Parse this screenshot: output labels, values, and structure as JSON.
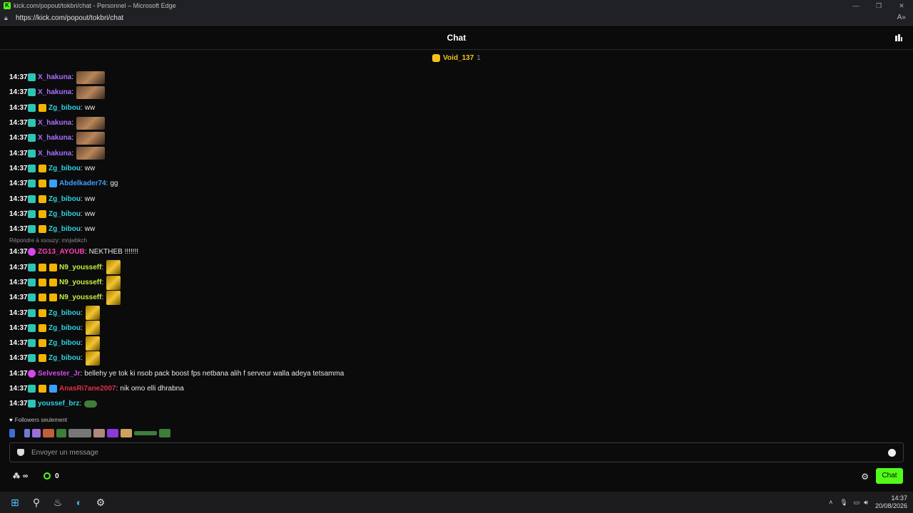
{
  "window": {
    "title": "kick.com/popout/tokbri/chat - Personnel – Microsoft Edge",
    "url": "https://kick.com/popout/tokbri/chat",
    "min": "—",
    "restore": "❐",
    "close": "✕"
  },
  "header": {
    "title": "Chat"
  },
  "pinned": {
    "user": "Void_137",
    "count": "1"
  },
  "messages": [
    {
      "time": "14:37",
      "badges": [
        "sub"
      ],
      "user": "X_hakuna",
      "color": "#a970ff",
      "emote": "photo"
    },
    {
      "time": "14:37",
      "badges": [
        "sub"
      ],
      "user": "X_hakuna",
      "color": "#a970ff",
      "emote": "photo"
    },
    {
      "time": "14:37",
      "badges": [
        "sub",
        "crown"
      ],
      "user": "Zg_bibou",
      "color": "#2ed1e0",
      "text": "ww"
    },
    {
      "time": "14:37",
      "badges": [
        "sub"
      ],
      "user": "X_hakuna",
      "color": "#a970ff",
      "emote": "photo"
    },
    {
      "time": "14:37",
      "badges": [
        "sub"
      ],
      "user": "X_hakuna",
      "color": "#a970ff",
      "emote": "photo"
    },
    {
      "time": "14:37",
      "badges": [
        "sub"
      ],
      "user": "X_hakuna",
      "color": "#a970ff",
      "emote": "photo"
    },
    {
      "time": "14:37",
      "badges": [
        "sub",
        "crown"
      ],
      "user": "Zg_bibou",
      "color": "#2ed1e0",
      "text": "ww"
    },
    {
      "time": "14:37",
      "badges": [
        "sub",
        "crown",
        "vip"
      ],
      "user": "Abdelkader74",
      "color": "#3aa0ff",
      "text": "gg"
    },
    {
      "time": "14:37",
      "badges": [
        "sub",
        "crown"
      ],
      "user": "Zg_bibou",
      "color": "#2ed1e0",
      "text": "ww"
    },
    {
      "time": "14:37",
      "badges": [
        "sub",
        "crown"
      ],
      "user": "Zg_bibou",
      "color": "#2ed1e0",
      "text": "ww"
    },
    {
      "time": "14:37",
      "badges": [
        "sub",
        "crown"
      ],
      "user": "Zg_bibou",
      "color": "#2ed1e0",
      "text": "ww"
    },
    {
      "reply": "Répondre à xsouzy: mnjwbkch"
    },
    {
      "time": "14:37",
      "badges": [
        "og"
      ],
      "user": "ZG13_AYOUB",
      "color": "#ff3fb4",
      "text": "NEKTHEB !!!!!!!"
    },
    {
      "time": "14:37",
      "badges": [
        "sub",
        "kick",
        "crown"
      ],
      "user": "N9_yousseff",
      "color": "#c6f03c",
      "emote": "gold"
    },
    {
      "time": "14:37",
      "badges": [
        "sub",
        "kick",
        "crown"
      ],
      "user": "N9_yousseff",
      "color": "#c6f03c",
      "emote": "gold"
    },
    {
      "time": "14:37",
      "badges": [
        "sub",
        "kick",
        "crown"
      ],
      "user": "N9_yousseff",
      "color": "#c6f03c",
      "emote": "gold"
    },
    {
      "time": "14:37",
      "badges": [
        "sub",
        "crown"
      ],
      "user": "Zg_bibou",
      "color": "#2ed1e0",
      "emote": "gold"
    },
    {
      "time": "14:37",
      "badges": [
        "sub",
        "crown"
      ],
      "user": "Zg_bibou",
      "color": "#2ed1e0",
      "emote": "gold"
    },
    {
      "time": "14:37",
      "badges": [
        "sub",
        "crown"
      ],
      "user": "Zg_bibou",
      "color": "#2ed1e0",
      "emote": "gold"
    },
    {
      "time": "14:37",
      "badges": [
        "sub",
        "crown"
      ],
      "user": "Zg_bibou",
      "color": "#2ed1e0",
      "emote": "gold"
    },
    {
      "time": "14:37",
      "badges": [
        "og"
      ],
      "user": "Selvester_Jr",
      "color": "#d946ef",
      "text": "bellehy ye tok ki nsob pack boost fps netbana alih f serveur walla adeya tetsamma"
    },
    {
      "time": "14:37",
      "badges": [
        "sub",
        "kick",
        "vip"
      ],
      "user": "AnasRi7ane2007",
      "color": "#e0304a",
      "text": "nik omo elli dhrabna"
    },
    {
      "time": "14:37",
      "badges": [
        "sub"
      ],
      "user": "youssef_brz",
      "color": "#2ed1e0",
      "emote": "pepe"
    }
  ],
  "footer": {
    "followers_label": "Followers seulement",
    "input_placeholder": "Envoyer un message",
    "infinite": "∞",
    "points": "0",
    "chat_button": "Chat"
  },
  "taskbar": {
    "time": "14:37",
    "date": "20/08/2026"
  },
  "colors": {
    "accent": "#53fc18",
    "bg": "#0b0b0c"
  }
}
